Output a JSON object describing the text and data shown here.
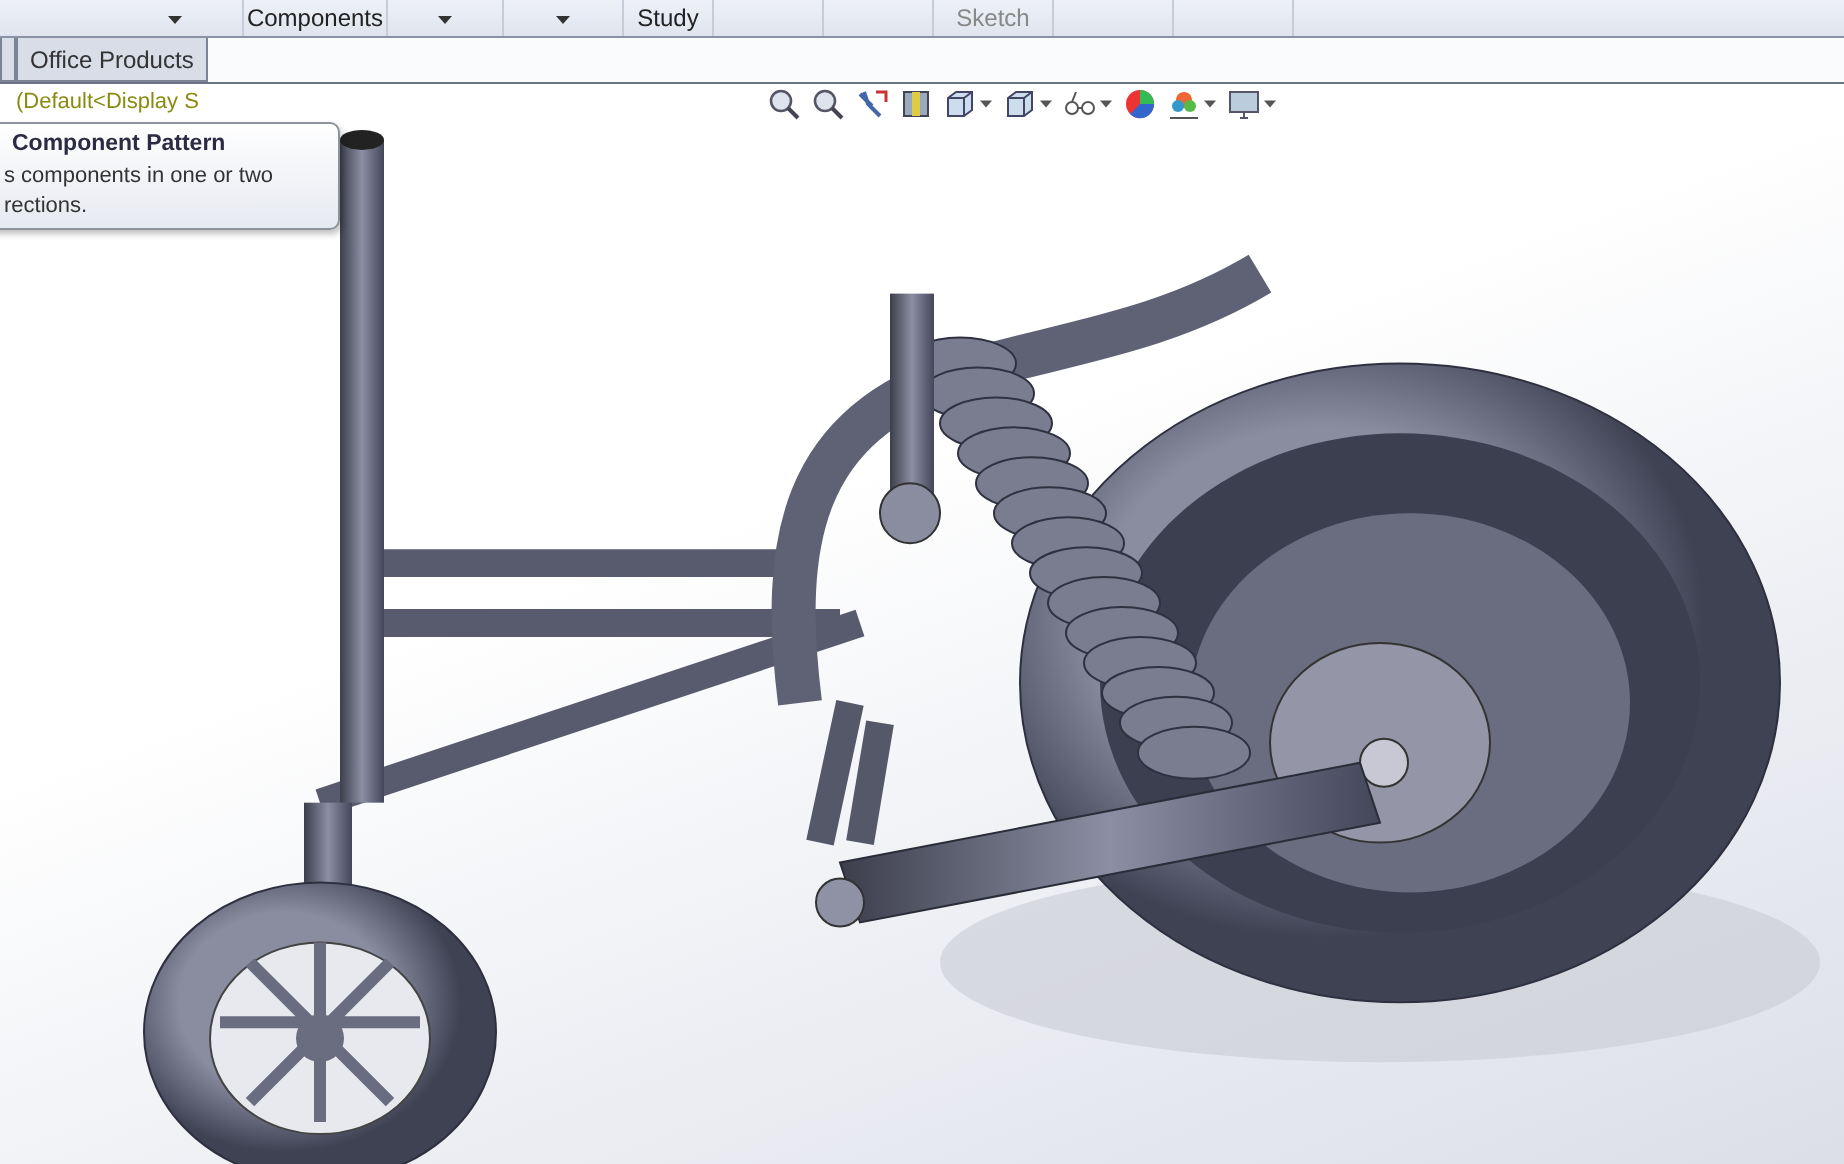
{
  "command_toolbar": [
    {
      "caret": true
    },
    {
      "label": "Components",
      "caret": false
    },
    {
      "caret": true
    },
    {
      "caret": true
    },
    {
      "label": "Study",
      "caret": false
    },
    {
      "caret": false
    },
    {
      "caret": false
    },
    {
      "label": "Sketch",
      "caret": false
    },
    {
      "caret": false
    },
    {
      "caret": false
    }
  ],
  "tabs": [
    {
      "label": "Office Products",
      "selected": false
    }
  ],
  "tree": {
    "configuration": "(Default<Display S"
  },
  "tooltip": {
    "title": "Component Pattern",
    "body": "s components in one or two\nrections."
  },
  "view_toolbar": [
    {
      "caret": false
    },
    {
      "caret": false
    },
    {
      "caret": false
    },
    {
      "caret": false
    },
    {
      "caret": true
    },
    {
      "caret": true
    },
    {
      "caret": true
    },
    {
      "caret": false
    },
    {
      "caret": true
    },
    {
      "caret": true
    }
  ]
}
